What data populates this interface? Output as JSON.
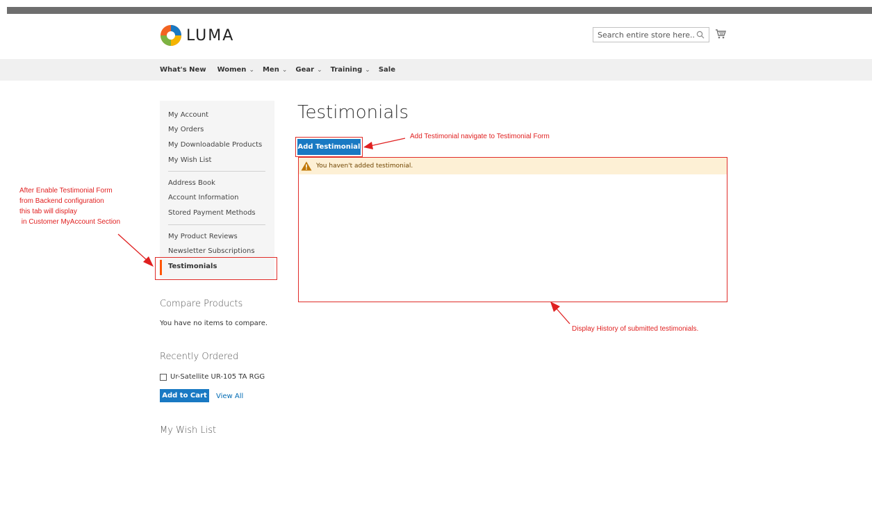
{
  "header": {
    "logo_text": "LUMA",
    "search": {
      "placeholder": "Search entire store here..."
    }
  },
  "nav": {
    "items": [
      {
        "label": "What's New",
        "has_dropdown": false
      },
      {
        "label": "Women",
        "has_dropdown": true
      },
      {
        "label": "Men",
        "has_dropdown": true
      },
      {
        "label": "Gear",
        "has_dropdown": true
      },
      {
        "label": "Training",
        "has_dropdown": true
      },
      {
        "label": "Sale",
        "has_dropdown": false
      }
    ]
  },
  "sidebar": {
    "items": [
      "My Account",
      "My Orders",
      "My Downloadable Products",
      "My Wish List",
      "Address Book",
      "Account Information",
      "Stored Payment Methods",
      "My Product Reviews",
      "Newsletter Subscriptions"
    ],
    "active": "Testimonials"
  },
  "compare": {
    "title": "Compare Products",
    "text": "You have no items to compare."
  },
  "recently_ordered": {
    "title": "Recently Ordered",
    "item": "Ur-Satellite UR-105 TA RGG",
    "add_to_cart": "Add to Cart",
    "view_all": "View All"
  },
  "wishlist": {
    "title": "My Wish List"
  },
  "main": {
    "title": "Testimonials",
    "add_button": "Add Testimonial",
    "message": "You haven't added testimonial."
  },
  "annotations": {
    "left": [
      "After Enable Testimonial Form",
      "from Backend configuration",
      "this tab will display",
      " in Customer MyAccount Section"
    ],
    "button": "Add Testimonial navigate to Testimonial Form",
    "history": "Display History of submitted testimonials."
  },
  "colors": {
    "accent": "#1979c3",
    "active_marker": "#ff5501",
    "annotation": "#e02020",
    "warning_bg": "#fdf0d5"
  }
}
